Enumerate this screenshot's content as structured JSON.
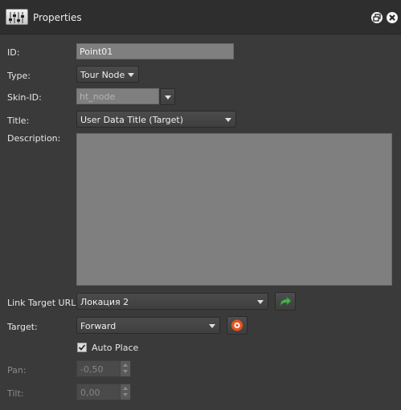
{
  "window": {
    "title": "Properties",
    "icon": "properties-sliders-icon",
    "controls": [
      "restore-icon",
      "close-icon"
    ]
  },
  "form": {
    "id_label": "ID:",
    "id_value": "Point01",
    "type_label": "Type:",
    "type_value": "Tour Node",
    "skin_id_label": "Skin-ID:",
    "skin_id_value": "ht_node",
    "title_label": "Title:",
    "title_value": "User Data Title (Target)",
    "description_label": "Description:",
    "description_value": "",
    "link_target_url_label": "Link Target URL:",
    "link_target_url_value": "Локация 2",
    "target_label": "Target:",
    "target_value": "Forward",
    "auto_place_label": "Auto Place",
    "auto_place_checked": true,
    "pan_label": "Pan:",
    "pan_value": "-0,50",
    "tilt_label": "Tilt:",
    "tilt_value": "0,00"
  },
  "colors": {
    "background": "#3a3a3a",
    "titlebar": "#2e2e2e",
    "field": "#7f7f7f",
    "go_arrow": "#4caf50",
    "target_icon": "#e8531f"
  },
  "icons": {
    "link_go_button": "arrow-forward-icon",
    "target_button": "target-ring-icon",
    "checkbox": "check-icon"
  }
}
